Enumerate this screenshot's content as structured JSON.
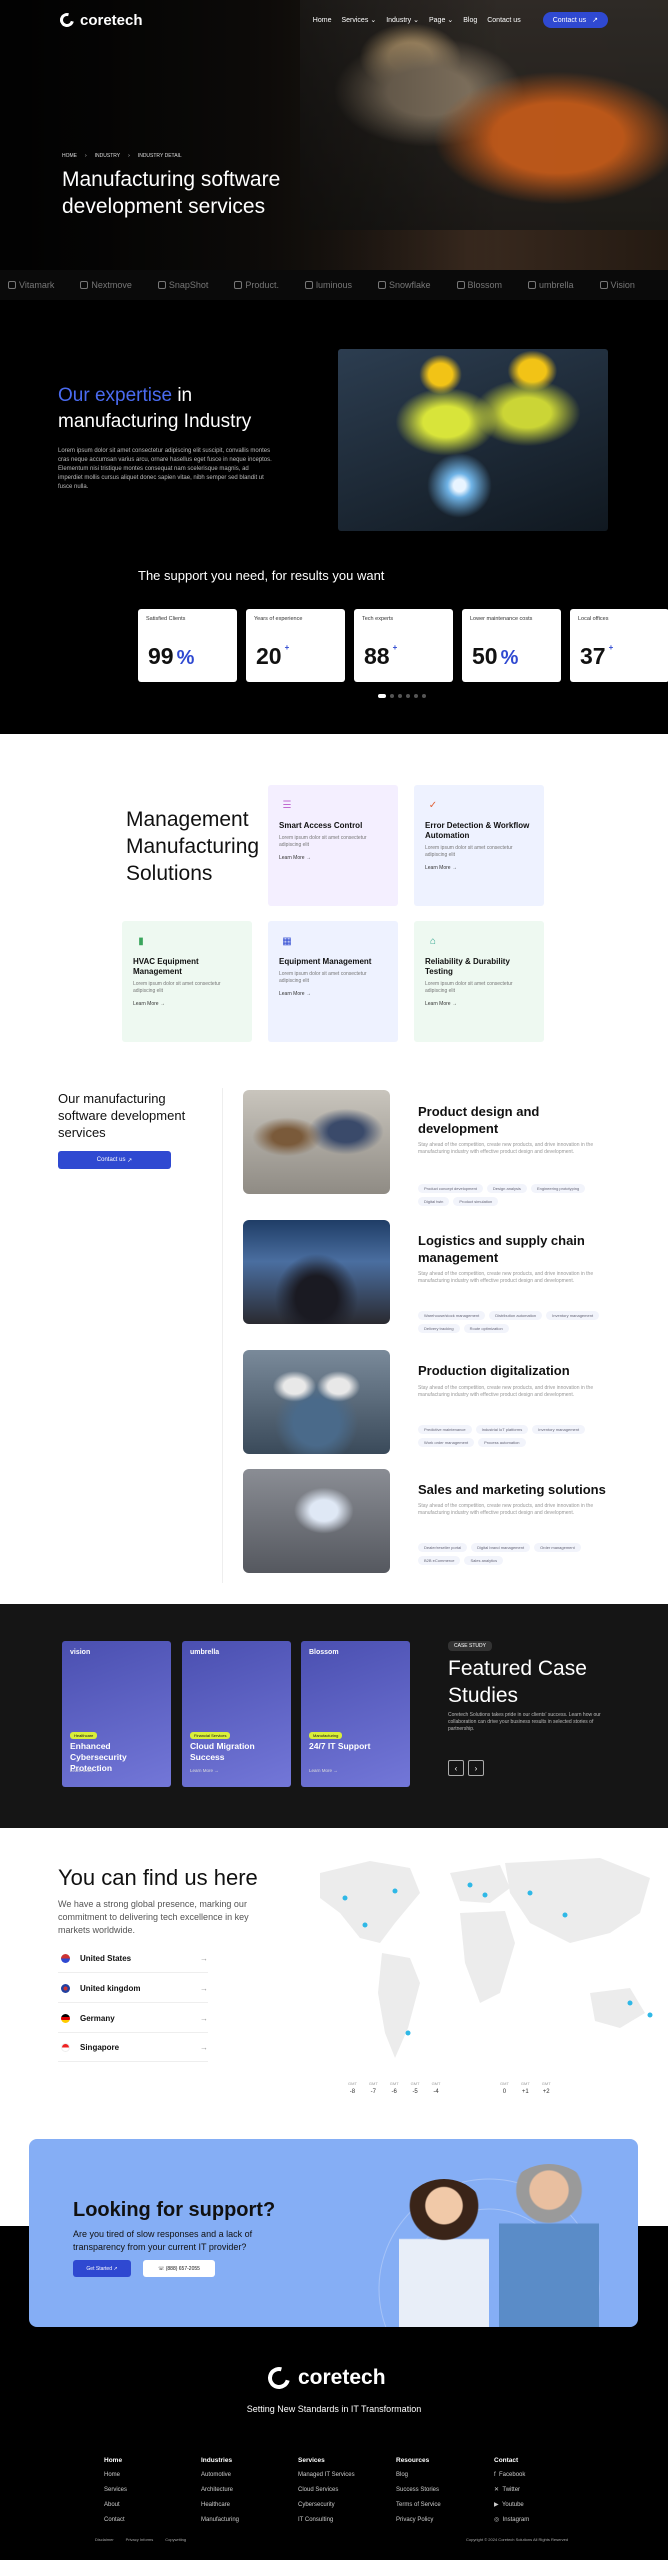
{
  "nav": {
    "brand": "coretech",
    "items": [
      "Home",
      "Services",
      "Industry",
      "Page",
      "Blog",
      "Contact us"
    ],
    "cta": "Contact us"
  },
  "hero": {
    "crumbs": [
      "HOME",
      "INDUSTRY",
      "INDUSTRY DETAIL"
    ],
    "title": "Manufacturing software development services"
  },
  "brands": [
    "Vitamark",
    "Nextmove",
    "SnapShot",
    "Product.",
    "luminous",
    "Snowflake",
    "Blossom",
    "umbrella",
    "Vision"
  ],
  "expertise": {
    "title_a": "Our expertise",
    "title_b": " in manufacturing Industry",
    "text": "Lorem ipsum dolor sit amet consectetur adipiscing elit suscipit, convallis montes cras neque accumsan varius arcu, ornare hasellus eget fusce in neque inceptos. Elementum nisi tristique montes consequat nam scelerisque magnis, ad imperdiet mollis cursus aliquet donec sapien vitae, nibh semper sed blandit ut fusce nulla."
  },
  "support": {
    "title": "The support you need, for results you want",
    "stats": [
      {
        "label": "Satisfied Clients",
        "value": "99",
        "suffix": "%"
      },
      {
        "label": "Years of experience",
        "value": "20",
        "suffix": "+"
      },
      {
        "label": "Tech experts",
        "value": "88",
        "suffix": "+"
      },
      {
        "label": "Lower maintenance costs",
        "value": "50",
        "suffix": "%"
      },
      {
        "label": "Local offices",
        "value": "37",
        "suffix": "+"
      }
    ]
  },
  "management": {
    "title": "Management Manufacturing Solutions",
    "cards": [
      {
        "title": "Smart Access Control",
        "text": "Lorem ipsum dolor sit amet consectetur adipiscing elit",
        "more": "Learn More"
      },
      {
        "title": "Error Detection & Workflow Automation",
        "text": "Lorem ipsum dolor sit amet consectetur adipiscing elit",
        "more": "Learn More"
      },
      {
        "title": "HVAC Equipment Management",
        "text": "Lorem ipsum dolor sit amet consectetur adipiscing elit",
        "more": "Learn More"
      },
      {
        "title": "Equipment Management",
        "text": "Lorem ipsum dolor sit amet consectetur adipiscing elit",
        "more": "Learn More"
      },
      {
        "title": "Reliability & Durability Testing",
        "text": "Lorem ipsum dolor sit amet consectetur adipiscing elit",
        "more": "Learn More"
      }
    ]
  },
  "services": {
    "title": "Our manufacturing software development services",
    "cta": "Contact us",
    "items": [
      {
        "title": "Product design and development",
        "text": "Stay ahead of the competition, create new products, and drive innovation in the manufacturing industry with effective product design and development.",
        "tags": [
          "Product concept development",
          "Design analysis",
          "Engineering prototyping",
          "Digital twin",
          "Product simulation"
        ]
      },
      {
        "title": "Logistics and supply chain management",
        "text": "Stay ahead of the competition, create new products, and drive innovation in the manufacturing industry with effective product design and development.",
        "tags": [
          "Warehouse/stock management",
          "Distribution automation",
          "Inventory management",
          "Delivery tracking",
          "Route optimization"
        ]
      },
      {
        "title": "Production digitalization",
        "text": "Stay ahead of the competition, create new products, and drive innovation in the manufacturing industry with effective product design and development.",
        "tags": [
          "Predictive maintenance",
          "Industrial IoT platforms",
          "Inventory management",
          "Work order management",
          "Process automation"
        ]
      },
      {
        "title": "Sales and marketing solutions",
        "text": "Stay ahead of the competition, create new products, and drive innovation in the manufacturing industry with effective product design and development.",
        "tags": [
          "Dealer/reseller portal",
          "Digital brand management",
          "Order management",
          "B2B eCommerce",
          "Sales analytics"
        ]
      }
    ]
  },
  "cases": {
    "tag": "CASE STUDY",
    "title": "Featured Case Studies",
    "text": "Coretech Solutions takes pride in our clients' success. Learn how our collaboration can drive your business results in selected stories of partnership.",
    "items": [
      {
        "logo": "vision",
        "badge": "Healthcare",
        "title": "Enhanced Cybersecurity Protection",
        "more": "Learn More"
      },
      {
        "logo": "umbrella",
        "badge": "Financial Services",
        "title": "Cloud Migration Success",
        "more": "Learn More"
      },
      {
        "logo": "Blossom",
        "badge": "Manufacturing",
        "title": "24/7 IT Support",
        "more": "Learn More"
      }
    ]
  },
  "find": {
    "title": "You can find us here",
    "text": "We have a strong global presence, marking our commitment to delivering tech excellence in key markets worldwide.",
    "locations": [
      "United States",
      "United kingdom",
      "Germany",
      "Singapore"
    ],
    "tz_left": [
      {
        "label": "GMT",
        "v": "-8"
      },
      {
        "label": "GMT",
        "v": "-7"
      },
      {
        "label": "GMT",
        "v": "-6"
      },
      {
        "label": "GMT",
        "v": "-5"
      },
      {
        "label": "GMT",
        "v": "-4"
      }
    ],
    "tz_right": [
      {
        "label": "GMT",
        "v": "0"
      },
      {
        "label": "GMT",
        "v": "+1"
      },
      {
        "label": "GMT",
        "v": "+2"
      }
    ]
  },
  "cta": {
    "title": "Looking for support?",
    "text": "Are you tired of slow responses and a lack of transparency from your current IT provider?",
    "b1": "Get Started",
    "b2": "(888) 657-2055"
  },
  "footer": {
    "brand": "coretech",
    "tagline": "Setting New Standards in IT Transformation",
    "cols": [
      {
        "h": "Home",
        "items": [
          "Home",
          "Services",
          "About",
          "Contact"
        ]
      },
      {
        "h": "Industries",
        "items": [
          "Automotive",
          "Architecture",
          "Healthcare",
          "Manufacturing"
        ]
      },
      {
        "h": "Services",
        "items": [
          "Managed IT Services",
          "Cloud Services",
          "Cybersecurity",
          "IT Consulting"
        ]
      },
      {
        "h": "Resources",
        "items": [
          "Blog",
          "Success Stories",
          "Terms of Service",
          "Privacy Policy"
        ]
      },
      {
        "h": "Contact",
        "items": [
          "Facebook",
          "Twitter",
          "Youtube",
          "Instagram"
        ]
      }
    ],
    "bottom": [
      "Disclaimer",
      "Privacy Informs",
      "Copywriting"
    ],
    "copy": "Copyright © 2024 Coretech Solutions All Rights Reserved"
  },
  "colors": {
    "accent": "#2f49d1",
    "cta_bg": "#85aef5"
  }
}
